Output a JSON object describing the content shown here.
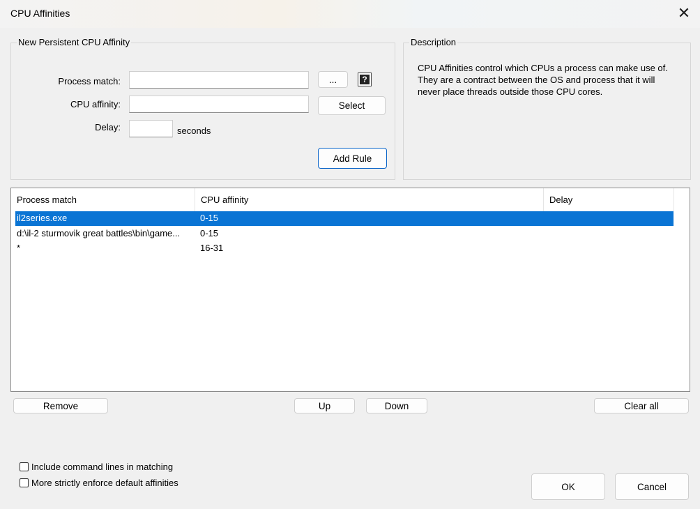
{
  "window": {
    "title": "CPU Affinities",
    "close_glyph": "✕"
  },
  "new_rule": {
    "group_title": "New Persistent CPU Affinity",
    "process_match_label": "Process match:",
    "process_match_value": "",
    "browse_label": "...",
    "help_glyph": "?",
    "cpu_affinity_label": "CPU affinity:",
    "cpu_affinity_value": "",
    "select_label": "Select",
    "delay_label": "Delay:",
    "delay_value": "",
    "delay_units": "seconds",
    "add_rule_label": "Add Rule"
  },
  "description": {
    "group_title": "Description",
    "text": "CPU Affinities control which CPUs a process can make use of. They are a contract between the OS and process that it will never place threads outside those CPU cores."
  },
  "rules_list": {
    "columns": [
      "Process match",
      "CPU affinity",
      "Delay"
    ],
    "rows": [
      {
        "process": "il2series.exe",
        "affinity": "0-15",
        "delay": "",
        "selected": true
      },
      {
        "process": "d:\\il-2 sturmovik great battles\\bin\\game...",
        "affinity": "0-15",
        "delay": "",
        "selected": false
      },
      {
        "process": "*",
        "affinity": "16-31",
        "delay": "",
        "selected": false
      }
    ]
  },
  "list_buttons": {
    "remove": "Remove",
    "up": "Up",
    "down": "Down",
    "clear_all": "Clear all"
  },
  "options": {
    "include_cmdlines": "Include command lines in matching",
    "strict_defaults": "More strictly enforce default affinities"
  },
  "footer": {
    "ok": "OK",
    "cancel": "Cancel"
  },
  "colors": {
    "selection": "#0a74d4",
    "default_button_border": "#0a64c8"
  }
}
